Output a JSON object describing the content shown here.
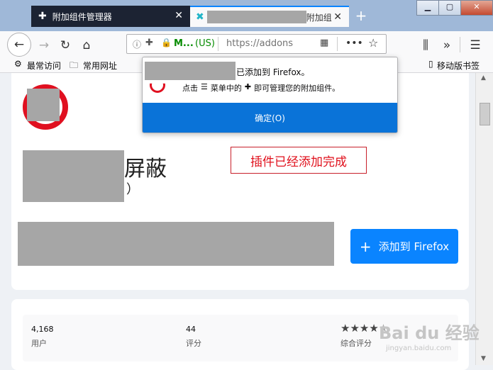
{
  "tabs": [
    {
      "label": "附加组件管理器",
      "active": false
    },
    {
      "label": "附加组",
      "active": true
    }
  ],
  "nav": {
    "site_name": "M...",
    "region": "(US)",
    "url": "https://addons"
  },
  "bookmarks": {
    "most_visited": "最常访问",
    "common_sites": "常用网址",
    "mobile": "移动版书签"
  },
  "popup": {
    "title_suffix": "已添加到 Firefox。",
    "hint_prefix": "点击",
    "hint_menu": "菜单中的",
    "hint_suffix": "即可管理您的附加组件。",
    "ok_label": "确定(O)"
  },
  "addon": {
    "name_suffix": "屏蔽",
    "name_paren": "）",
    "add_button": "添加到 Firefox"
  },
  "annotation": "插件已经添加完成",
  "stats": {
    "users_value": "4,168",
    "users_label": "用户",
    "reviews_value": "44",
    "reviews_label": "评分",
    "rating_label": "综合评分",
    "rating_stars": 4.5
  },
  "watermark": {
    "brand": "Bai du 经验",
    "url": "jingyan.baidu.com"
  },
  "colors": {
    "accent": "#0a84ff",
    "ok_button": "#0a73d8",
    "annotation_red": "#e0101c",
    "secure_green": "#12bc00"
  }
}
